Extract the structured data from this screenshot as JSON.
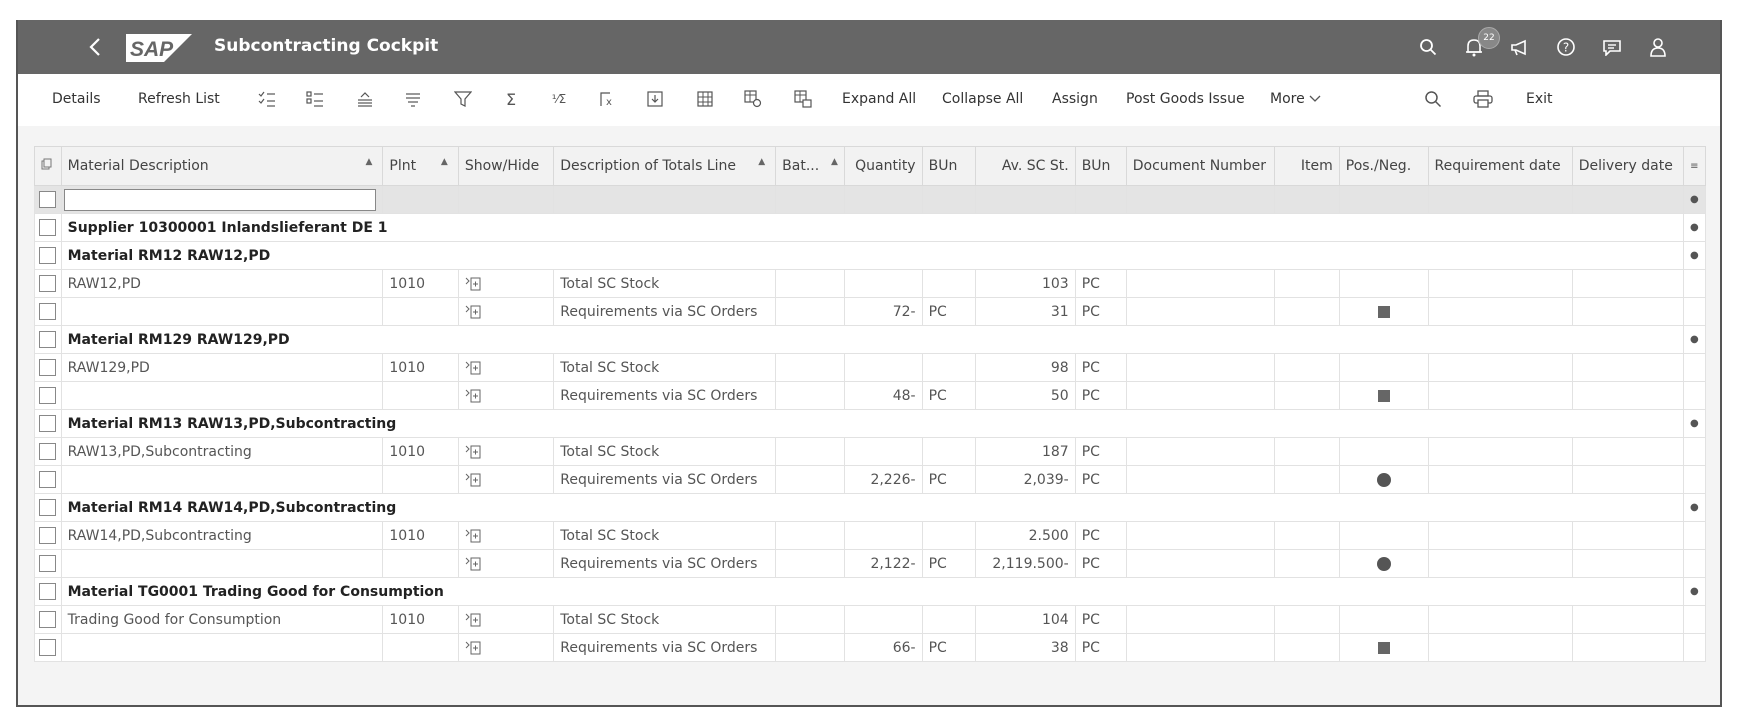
{
  "shell": {
    "title": "Subcontracting Cockpit",
    "logo_text": "SAP",
    "notification_count": "22",
    "icons": [
      "back-icon",
      "search-icon",
      "bell-icon",
      "megaphone-icon",
      "help-icon",
      "feedback-icon",
      "user-icon"
    ]
  },
  "toolbar": {
    "details": "Details",
    "refresh": "Refresh List",
    "expand_all": "Expand All",
    "collapse_all": "Collapse All",
    "assign": "Assign",
    "post_goods_issue": "Post Goods Issue",
    "more": "More",
    "exit": "Exit",
    "fraction_icon": "¹⁄Σ",
    "sum_icon": "Σ"
  },
  "table": {
    "headers": {
      "material_description": "Material Description",
      "plnt": "Plnt",
      "show_hide": "Show/Hide",
      "totals_desc": "Description of Totals Line",
      "batch": "Bat...",
      "quantity": "Quantity",
      "bun1": "BUn",
      "av_sc_st": "Av. SC St.",
      "bun2": "BUn",
      "document_number": "Document Number",
      "item": "Item",
      "pos_neg": "Pos./Neg.",
      "requirement_date": "Requirement date",
      "delivery_date": "Delivery date"
    },
    "groups": [
      "Supplier 10300001 Inlandslieferant DE 1",
      "Material RM12 RAW12,PD",
      "Material RM129 RAW129,PD",
      "Material RM13 RAW13,PD,Subcontracting",
      "Material RM14 RAW14,PD,Subcontracting",
      "Material TG0001 Trading Good for Consumption"
    ],
    "rows": [
      {
        "desc": "RAW12,PD",
        "plant": "1010",
        "totals": "Total SC Stock",
        "qty": "",
        "bun1": "",
        "avsc": "103",
        "bun2": "PC",
        "posneg": ""
      },
      {
        "desc": "",
        "plant": "",
        "totals": "Requirements via SC Orders",
        "qty": "72-",
        "bun1": "PC",
        "avsc": "31",
        "bun2": "PC",
        "posneg": "square"
      },
      {
        "desc": "RAW129,PD",
        "plant": "1010",
        "totals": "Total SC Stock",
        "qty": "",
        "bun1": "",
        "avsc": "98",
        "bun2": "PC",
        "posneg": ""
      },
      {
        "desc": "",
        "plant": "",
        "totals": "Requirements via SC Orders",
        "qty": "48-",
        "bun1": "PC",
        "avsc": "50",
        "bun2": "PC",
        "posneg": "square"
      },
      {
        "desc": "RAW13,PD,Subcontracting",
        "plant": "1010",
        "totals": "Total SC Stock",
        "qty": "",
        "bun1": "",
        "avsc": "187",
        "bun2": "PC",
        "posneg": ""
      },
      {
        "desc": "",
        "plant": "",
        "totals": "Requirements via SC Orders",
        "qty": "2,226-",
        "bun1": "PC",
        "avsc": "2,039-",
        "bun2": "PC",
        "posneg": "circle"
      },
      {
        "desc": "RAW14,PD,Subcontracting",
        "plant": "1010",
        "totals": "Total SC Stock",
        "qty": "",
        "bun1": "",
        "avsc": "2.500",
        "bun2": "PC",
        "posneg": ""
      },
      {
        "desc": "",
        "plant": "",
        "totals": "Requirements via SC Orders",
        "qty": "2,122-",
        "bun1": "PC",
        "avsc": "2,119.500-",
        "bun2": "PC",
        "posneg": "circle"
      },
      {
        "desc": "Trading Good for Consumption",
        "plant": "1010",
        "totals": "Total SC Stock",
        "qty": "",
        "bun1": "",
        "avsc": "104",
        "bun2": "PC",
        "posneg": ""
      },
      {
        "desc": "",
        "plant": "",
        "totals": "Requirements via SC Orders",
        "qty": "66-",
        "bun1": "PC",
        "avsc": "38",
        "bun2": "PC",
        "posneg": "square"
      }
    ]
  }
}
